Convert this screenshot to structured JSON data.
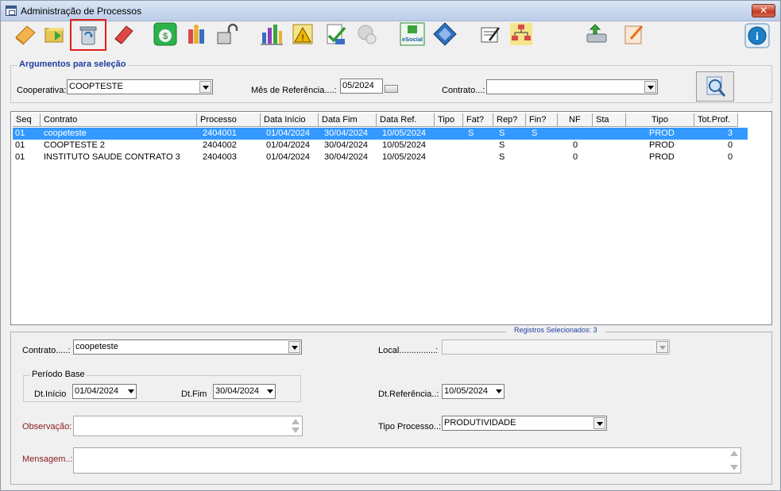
{
  "window": {
    "title": "Administração de Processos",
    "close_label": "✕"
  },
  "toolbar": {
    "buttons": [
      {
        "name": "new-icon"
      },
      {
        "name": "open-folder-icon"
      },
      {
        "name": "recycle-bin-icon"
      },
      {
        "name": "eraser-icon"
      },
      {
        "name": "money-bag-icon"
      },
      {
        "name": "gift-icon"
      },
      {
        "name": "unlock-icon"
      },
      {
        "name": "bar-chart-icon"
      },
      {
        "name": "warning-doc-icon"
      },
      {
        "name": "approve-doc-icon"
      },
      {
        "name": "user-disabled-icon"
      },
      {
        "name": "esocial-icon",
        "label": "eSocial"
      },
      {
        "name": "send-diamond-icon"
      },
      {
        "name": "sign-doc-icon"
      },
      {
        "name": "org-chart-icon"
      },
      {
        "name": "save-drive-icon"
      },
      {
        "name": "edit-note-icon"
      },
      {
        "name": "info-icon"
      }
    ]
  },
  "selection": {
    "legend": "Argumentos para seleção",
    "cooperativa_label": "Cooperativa:",
    "cooperativa_value": "COOPTESTE",
    "mes_label": "Mês de Referência....:",
    "mes_value": "05/2024",
    "contrato_label": "Contrato...:",
    "contrato_value": ""
  },
  "grid": {
    "columns": [
      "Seq",
      "Contrato",
      "Processo",
      "Data Início",
      "Data Fim",
      "Data Ref.",
      "Tipo",
      "Fat?",
      "Rep?",
      "Fin?",
      "NF",
      "Sta",
      "Tipo",
      "Tot.Prof."
    ],
    "rows": [
      {
        "seq": "01",
        "contrato": "coopeteste",
        "processo": "2404001",
        "inicio": "01/04/2024",
        "fim": "30/04/2024",
        "ref": "10/05/2024",
        "tipo": "",
        "fat": "S",
        "rep": "S",
        "fin": "S",
        "nf": "",
        "sta": "",
        "tipo2": "PROD",
        "tot": "3"
      },
      {
        "seq": "01",
        "contrato": "COOPTESTE 2",
        "processo": "2404002",
        "inicio": "01/04/2024",
        "fim": "30/04/2024",
        "ref": "10/05/2024",
        "tipo": "",
        "fat": "",
        "rep": "S",
        "fin": "",
        "nf": "0",
        "sta": "",
        "tipo2": "PROD",
        "tot": "0"
      },
      {
        "seq": "01",
        "contrato": "INSTITUTO SAUDE CONTRATO 3",
        "processo": "2404003",
        "inicio": "01/04/2024",
        "fim": "30/04/2024",
        "ref": "10/05/2024",
        "tipo": "",
        "fat": "",
        "rep": "S",
        "fin": "",
        "nf": "0",
        "sta": "",
        "tipo2": "PROD",
        "tot": "0"
      }
    ],
    "registros": "Registros Selecionados: 3"
  },
  "detail": {
    "contrato_label": "Contrato.....:",
    "contrato_value": "coopeteste",
    "local_label": "Local...............:",
    "local_value": "",
    "periodo_legend": "Período Base",
    "dtinicio_label": "Dt.Início",
    "dtinicio_value": "01/04/2024",
    "dtfim_label": "Dt.Fim",
    "dtfim_value": "30/04/2024",
    "dtref_label": "Dt.Referência..:",
    "dtref_value": "10/05/2024",
    "observacao_label": "Observação:",
    "observacao_value": "",
    "tipo_label": "Tipo Processo..:",
    "tipo_value": "PRODUTIVIDADE",
    "mensagem_label": "Mensagem..:",
    "mensagem_value": ""
  },
  "colors": {
    "selection": "#3399ff",
    "registros_text": "#1f3fa0",
    "accent_red": "#8a1c1c"
  }
}
